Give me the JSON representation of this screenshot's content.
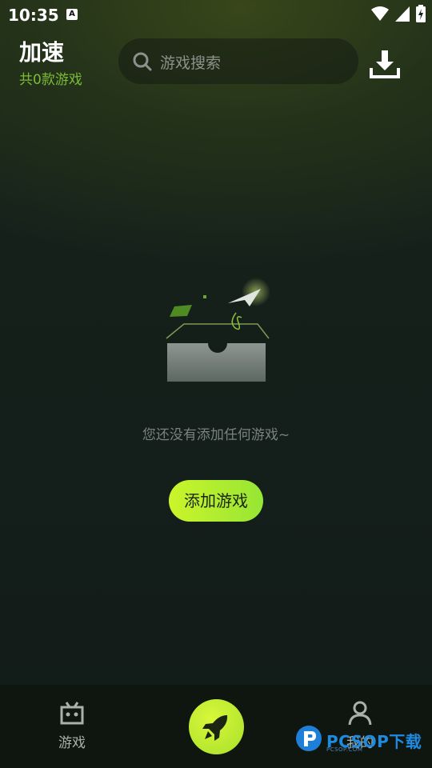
{
  "status_bar": {
    "time": "10:35",
    "notif_icon_text": "A"
  },
  "header": {
    "title": "加速",
    "subtitle": "共0款游戏"
  },
  "search": {
    "placeholder": "游戏搜索"
  },
  "empty_state": {
    "message": "您还没有添加任何游戏~",
    "add_button_label": "添加游戏"
  },
  "bottom_nav": {
    "items": [
      {
        "label": "游戏",
        "icon": "gamepad-icon"
      },
      {
        "label": "",
        "icon": "rocket-icon"
      },
      {
        "label": "我的",
        "icon": "user-icon"
      }
    ]
  },
  "watermark": {
    "text": "PCSOP下载",
    "sub": "PCSOP.COM"
  },
  "colors": {
    "accent": "#b9ee2f",
    "subtitle_green": "#7bbd35",
    "background": "#121b18"
  }
}
